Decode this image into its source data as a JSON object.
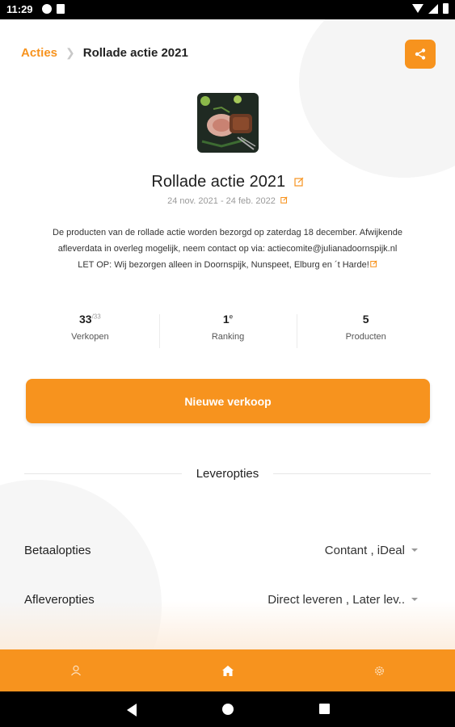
{
  "status_bar": {
    "time": "11:29"
  },
  "breadcrumb": {
    "parent": "Acties",
    "current": "Rollade actie 2021"
  },
  "icons": {
    "share": "share-icon",
    "edit": "edit-icon",
    "profile": "person-icon",
    "home": "home-icon",
    "settings": "gear-icon"
  },
  "colors": {
    "accent": "#f7931e"
  },
  "campaign": {
    "title": "Rollade actie 2021",
    "dates": "24 nov. 2021 - 24 feb. 2022",
    "description": [
      "De producten van de rollade actie worden bezorgd op zaterdag 18 december. Afwijkende",
      "afleverdata in overleg mogelijk, neem contact op via: actiecomite@julianadoornspijk.nl",
      "LET OP: Wij bezorgen alleen in Doornspijk, Nunspeet, Elburg en ´t Harde!"
    ]
  },
  "stats": {
    "sales": {
      "value": "33",
      "sup": "/33",
      "label": "Verkopen"
    },
    "ranking": {
      "value": "1",
      "sup": "e",
      "label": "Ranking"
    },
    "products": {
      "value": "5",
      "label": "Producten"
    }
  },
  "new_sale_button": "Nieuwe verkoop",
  "delivery_section": {
    "title": "Leveropties",
    "payment": {
      "label": "Betaalopties",
      "value": "Contant , iDeal"
    },
    "delivery": {
      "label": "Afleveropties",
      "value": "Direct leveren , Later lev.."
    }
  }
}
